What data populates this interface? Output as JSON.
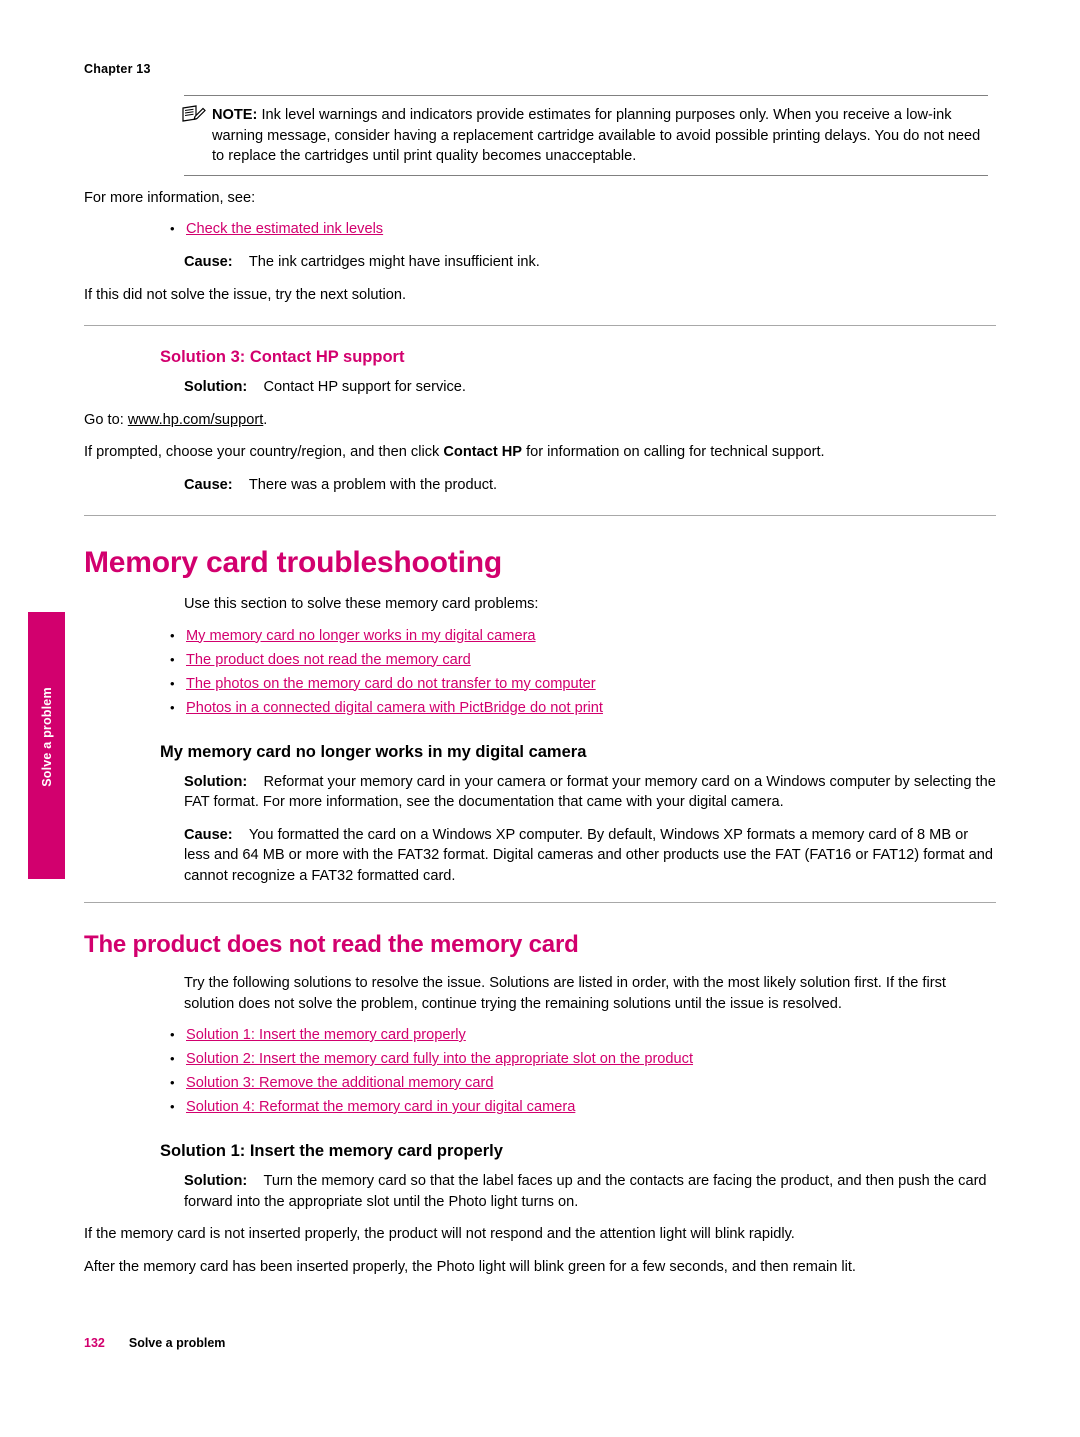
{
  "page": {
    "chapter_label": "Chapter 13",
    "side_tab_text": "Solve a problem",
    "footer_page_number": "132",
    "footer_title": "Solve a problem",
    "accent_color": "#d2006e"
  },
  "note": {
    "icon": "note-pencil-icon",
    "label": "NOTE:",
    "text": "Ink level warnings and indicators provide estimates for planning purposes only. When you receive a low-ink warning message, consider having a replacement cartridge available to avoid possible printing delays. You do not need to replace the cartridges until print quality becomes unacceptable."
  },
  "ink_section": {
    "more_info": "For more information, see:",
    "links": [
      "Check the estimated ink levels"
    ],
    "cause_label": "Cause:",
    "cause_text": "The ink cartridges might have insufficient ink.",
    "next_solution": "If this did not solve the issue, try the next solution."
  },
  "solution3": {
    "heading": "Solution 3: Contact HP support",
    "solution_label": "Solution:",
    "solution_text": "Contact HP support for service.",
    "goto_prefix": "Go to: ",
    "goto_link": "www.hp.com/support",
    "goto_suffix": ".",
    "prompt_text_1": "If prompted, choose your country/region, and then click ",
    "prompt_bold": "Contact HP",
    "prompt_text_2": " for information on calling for technical support.",
    "cause_label": "Cause:",
    "cause_text": "There was a problem with the product."
  },
  "memory_card": {
    "title": "Memory card troubleshooting",
    "intro": "Use this section to solve these memory card problems:",
    "links": [
      "My memory card no longer works in my digital camera",
      "The product does not read the memory card",
      "The photos on the memory card do not transfer to my computer",
      "Photos in a connected digital camera with PictBridge do not print"
    ]
  },
  "no_longer_works": {
    "heading": "My memory card no longer works in my digital camera",
    "solution_label": "Solution:",
    "solution_text": "Reformat your memory card in your camera or format your memory card on a Windows computer by selecting the FAT format. For more information, see the documentation that came with your digital camera.",
    "cause_label": "Cause:",
    "cause_text": "You formatted the card on a Windows XP computer. By default, Windows XP formats a memory card of 8 MB or less and 64 MB or more with the FAT32 format. Digital cameras and other products use the FAT (FAT16 or FAT12) format and cannot recognize a FAT32 formatted card."
  },
  "does_not_read": {
    "title": "The product does not read the memory card",
    "intro": "Try the following solutions to resolve the issue. Solutions are listed in order, with the most likely solution first. If the first solution does not solve the problem, continue trying the remaining solutions until the issue is resolved.",
    "links": [
      "Solution 1: Insert the memory card properly",
      "Solution 2: Insert the memory card fully into the appropriate slot on the product",
      "Solution 3: Remove the additional memory card",
      "Solution 4: Reformat the memory card in your digital camera"
    ]
  },
  "solution1": {
    "heading": "Solution 1: Insert the memory card properly",
    "solution_label": "Solution:",
    "solution_text": "Turn the memory card so that the label faces up and the contacts are facing the product, and then push the card forward into the appropriate slot until the Photo light turns on.",
    "para2": "If the memory card is not inserted properly, the product will not respond and the attention light will blink rapidly.",
    "para3": "After the memory card has been inserted properly, the Photo light will blink green for a few seconds, and then remain lit."
  }
}
